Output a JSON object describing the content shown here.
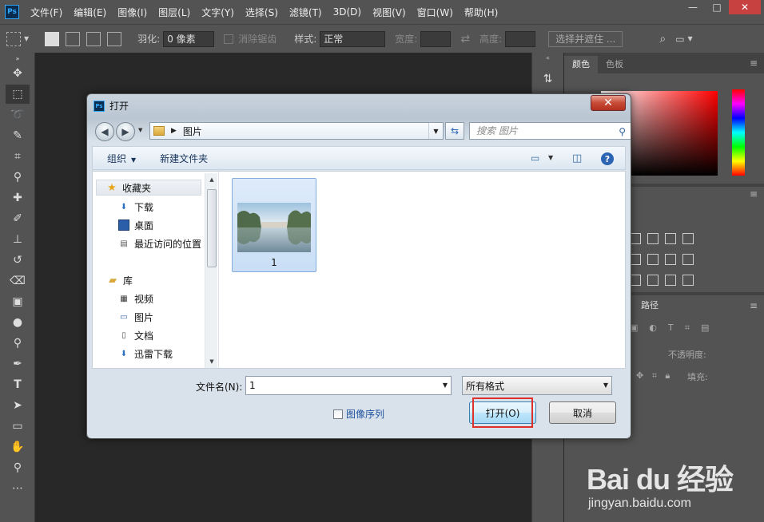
{
  "app": {
    "logo": "Ps",
    "menu": [
      "文件(F)",
      "编辑(E)",
      "图像(I)",
      "图层(L)",
      "文字(Y)",
      "选择(S)",
      "滤镜(T)",
      "3D(D)",
      "视图(V)",
      "窗口(W)",
      "帮助(H)"
    ]
  },
  "options": {
    "feather_label": "羽化:",
    "feather_value": "0 像素",
    "antialias_label": "消除锯齿",
    "style_label": "样式:",
    "style_value": "正常",
    "width_label": "宽度:",
    "height_label": "高度:",
    "select_mask_label": "选择并遮住 ..."
  },
  "panels": {
    "color_tab": "颜色",
    "swatches_tab": "色板",
    "paths_tab": "路径",
    "opacity_label": "不透明度:",
    "fill_label": "填充:"
  },
  "dialog": {
    "title": "打开",
    "address_crumb": "图片",
    "search_placeholder": "搜索 图片",
    "organize_label": "组织",
    "new_folder_label": "新建文件夹",
    "nav": {
      "favorites": "收藏夹",
      "downloads": "下载",
      "desktop": "桌面",
      "recent": "最近访问的位置",
      "libraries": "库",
      "videos": "视频",
      "pictures": "图片",
      "documents": "文档",
      "thunder": "迅雷下载"
    },
    "file": {
      "name": "1"
    },
    "filename_label": "文件名(N):",
    "filename_value": "1",
    "filetype_value": "所有格式",
    "image_sequence_label": "图像序列",
    "open_button": "打开(O)",
    "cancel_button": "取消"
  },
  "watermark": {
    "brand": "Bai du 经验",
    "url": "jingyan.baidu.com"
  },
  "colors": {
    "ps_bg": "#282828",
    "ps_chrome": "#535353",
    "highlight": "#e0302a",
    "link_blue": "#1f52a0"
  }
}
